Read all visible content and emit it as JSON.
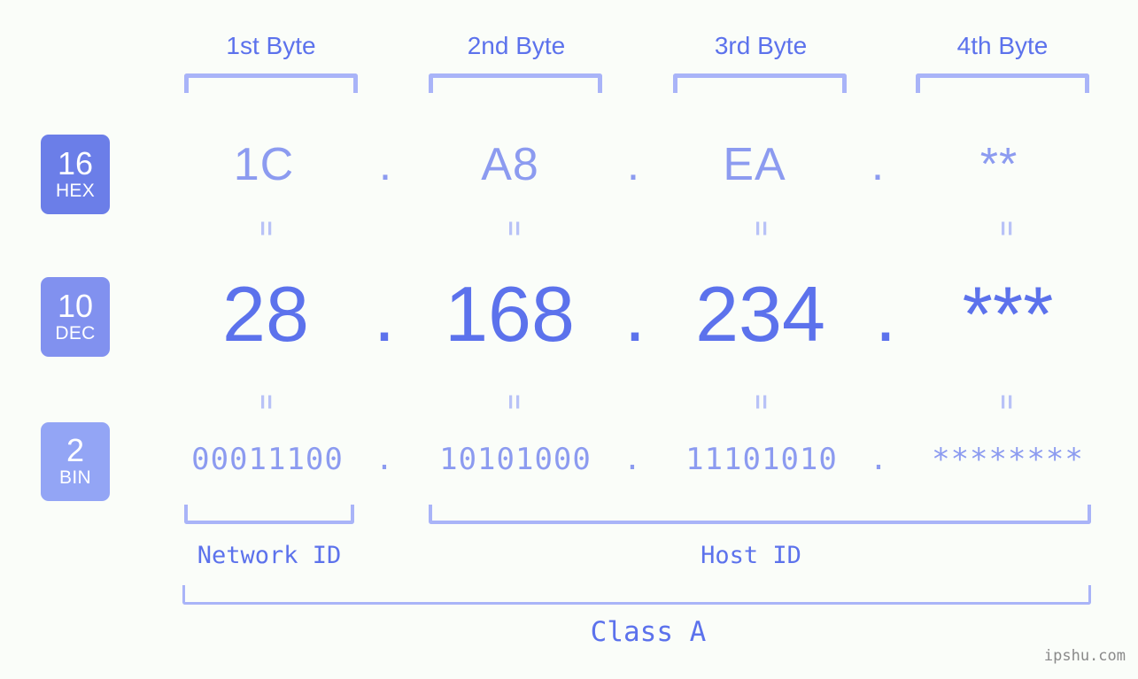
{
  "background_color": "#fafdf9",
  "accent_strong": "#5c72ec",
  "accent_light": "#8c9bf0",
  "bracket_color": "#a9b4f8",
  "byte_headers": [
    {
      "label": "1st Byte"
    },
    {
      "label": "2nd Byte"
    },
    {
      "label": "3rd Byte"
    },
    {
      "label": "4th Byte"
    }
  ],
  "bases": [
    {
      "number": "16",
      "abbr": "HEX",
      "color": "#6b7ee8"
    },
    {
      "number": "10",
      "abbr": "DEC",
      "color": "#8191ef"
    },
    {
      "number": "2",
      "abbr": "BIN",
      "color": "#93a5f5"
    }
  ],
  "rows": {
    "hex": {
      "octets": [
        "1C",
        "A8",
        "EA",
        "**"
      ],
      "separators": [
        ".",
        ".",
        "."
      ]
    },
    "dec": {
      "octets": [
        "28",
        "168",
        "234",
        "***"
      ],
      "separators": [
        ".",
        ".",
        "."
      ]
    },
    "bin": {
      "octets": [
        "00011100",
        "10101000",
        "11101010",
        "********"
      ],
      "separators": [
        ".",
        ".",
        "."
      ]
    }
  },
  "equals_glyph": "=",
  "sections": {
    "network_id": "Network ID",
    "host_id": "Host ID",
    "class": "Class A"
  },
  "watermark": "ipshu.com"
}
